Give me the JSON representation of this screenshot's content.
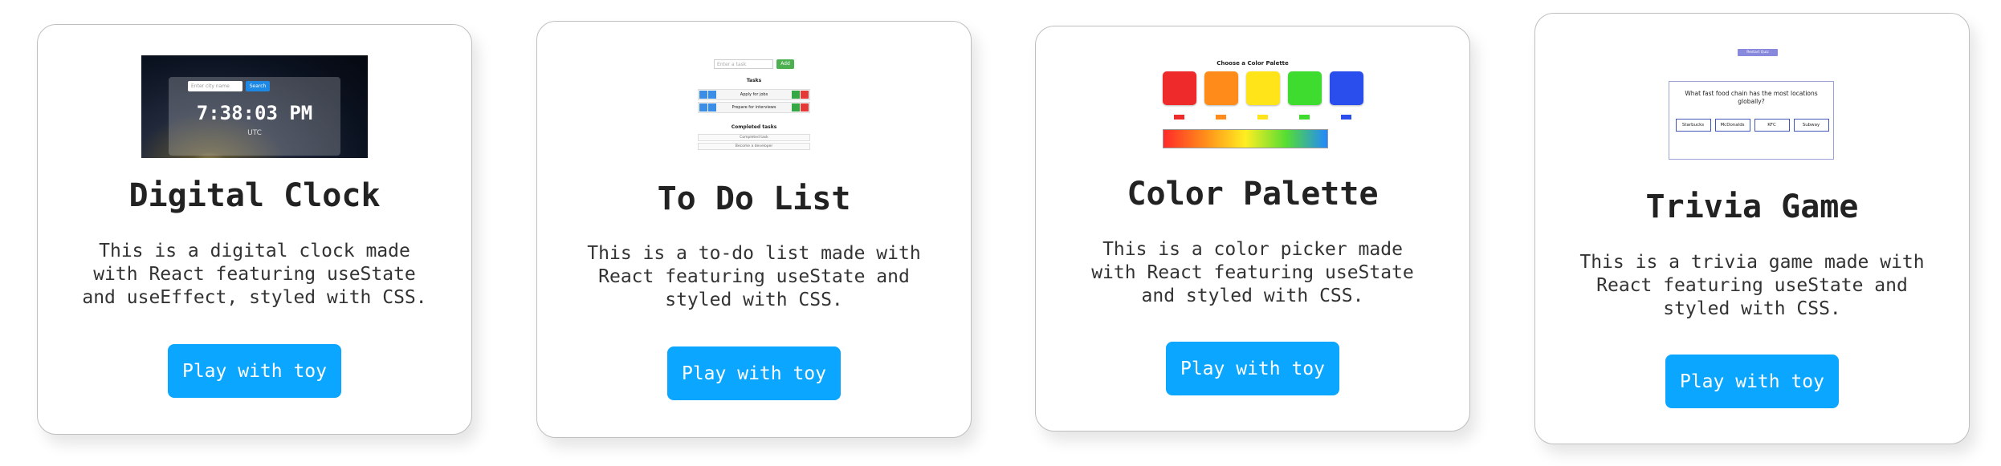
{
  "cards": [
    {
      "title": "Digital Clock",
      "description": "This is a digital clock made with React featuring useState and useEffect, styled with CSS.",
      "button_label": "Play with toy",
      "preview": {
        "input_placeholder": "Enter city name",
        "search_label": "Search",
        "time": "7:38:03 PM",
        "timezone": "UTC"
      }
    },
    {
      "title": "To Do List",
      "description": "This is a to-do list made with React featuring useState and styled with CSS.",
      "button_label": "Play with toy",
      "preview": {
        "input_placeholder": "Enter a task",
        "add_label": "Add",
        "tasks_heading": "Tasks",
        "tasks": [
          "Apply for jobs",
          "Prepare for interviews"
        ],
        "completed_heading": "Completed tasks",
        "completed": [
          "Completed task",
          "Become a developer"
        ]
      }
    },
    {
      "title": "Color Palette",
      "description": "This is a color picker made with React featuring useState and styled with CSS.",
      "button_label": "Play with toy",
      "preview": {
        "heading": "Choose a Color Palette",
        "swatch_colors": [
          "#ee2a2a",
          "#ff8c1a",
          "#ffe41a",
          "#3ddc2e",
          "#2a4dee"
        ]
      }
    },
    {
      "title": "Trivia Game",
      "description": "This is a trivia game made with React featuring useState and styled with CSS.",
      "button_label": "Play with toy",
      "preview": {
        "top_label": "Restart Quiz",
        "question": "What fast food chain has the most locations globally?",
        "answers": [
          "Starbucks",
          "McDonalds",
          "KFC",
          "Subway"
        ]
      }
    }
  ],
  "colors": {
    "button": "#0ba6ff",
    "card_border": "#bfbfbf"
  }
}
